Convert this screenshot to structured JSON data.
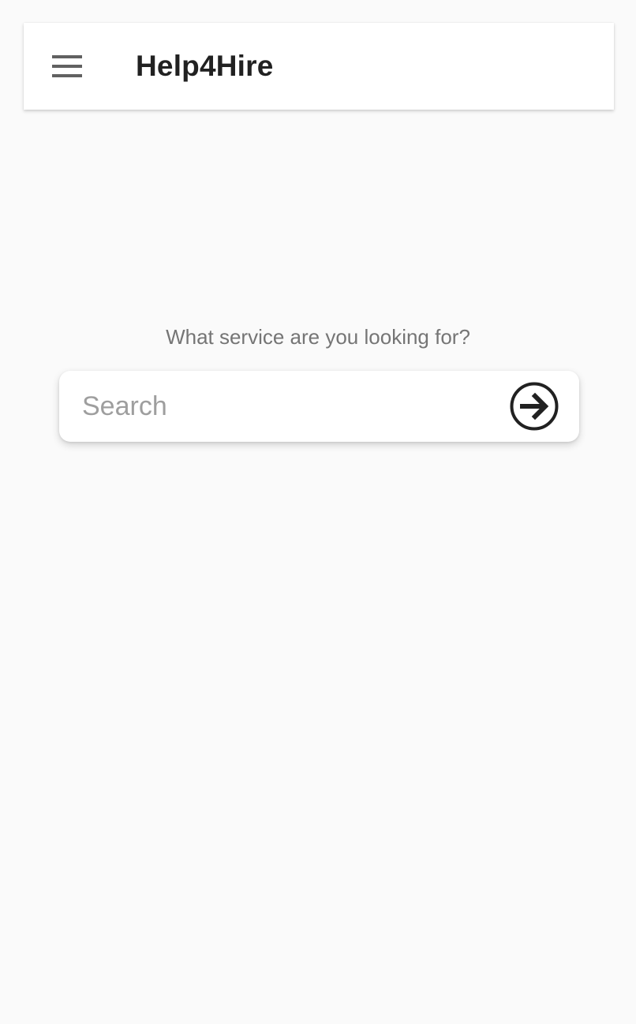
{
  "app_bar": {
    "title": "Help4Hire",
    "menu_icon": "hamburger-menu-icon"
  },
  "main": {
    "prompt": "What service are you looking for?",
    "search": {
      "placeholder": "Search",
      "value": "",
      "submit_icon": "arrow-right-circle-icon"
    }
  },
  "colors": {
    "background": "#fafafa",
    "surface": "#ffffff",
    "title_text": "#212121",
    "secondary_text": "#757575",
    "placeholder_text": "#9e9e9e",
    "icon": "#212121",
    "menu_icon": "#616161"
  }
}
